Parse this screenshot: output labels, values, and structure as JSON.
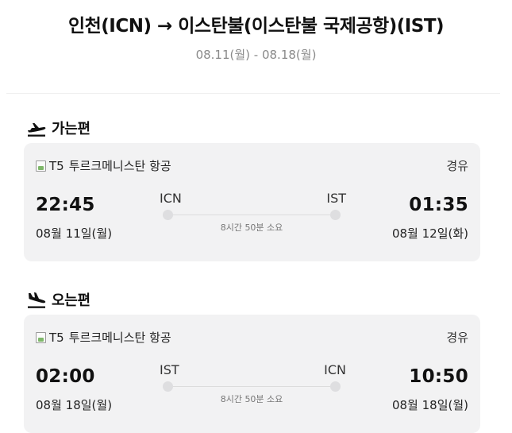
{
  "header": {
    "route_title": "인천(ICN) → 이스탄불(이스탄불 국제공항)(IST)",
    "date_range": "08.11(월) - 08.18(월)"
  },
  "sections": [
    {
      "title": "가는편",
      "icon": "plane-takeoff-icon",
      "airline_code": "T5",
      "airline_name": "투르크메니스탄 항공",
      "stop_type": "경유",
      "departure": {
        "time": "22:45",
        "date": "08월 11일(월)",
        "code": "ICN"
      },
      "arrival": {
        "time": "01:35",
        "date": "08월 12일(화)",
        "code": "IST"
      },
      "duration": "8시간 50분 소요"
    },
    {
      "title": "오는편",
      "icon": "plane-landing-icon",
      "airline_code": "T5",
      "airline_name": "투르크메니스탄 항공",
      "stop_type": "경유",
      "departure": {
        "time": "02:00",
        "date": "08월 18일(월)",
        "code": "IST"
      },
      "arrival": {
        "time": "10:50",
        "date": "08월 18일(월)",
        "code": "ICN"
      },
      "duration": "8시간 50분 소요"
    }
  ],
  "colors": {
    "card_background": "#f2f2f3",
    "muted_text": "#8a8a8a",
    "track": "#dcdcdc"
  }
}
